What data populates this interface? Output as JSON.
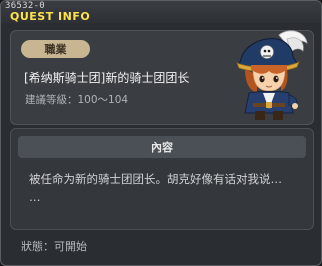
{
  "window": {
    "quest_id": "36532-0",
    "title": "QUEST INFO"
  },
  "quest": {
    "category_badge": "職業",
    "name": "[希纳斯骑士团]新的骑士团团长",
    "level_requirement": "建議等級：100～104"
  },
  "content": {
    "header": "內容",
    "line1": "被任命为新的骑士团团长。胡克好像有话对我说…",
    "line2": "…"
  },
  "status": {
    "text": "狀態：可開始"
  },
  "colors": {
    "title": "#ffe34a",
    "badge_bg": "#c8b692"
  },
  "icons": {
    "npc_portrait": "pirate-captain-npc"
  }
}
